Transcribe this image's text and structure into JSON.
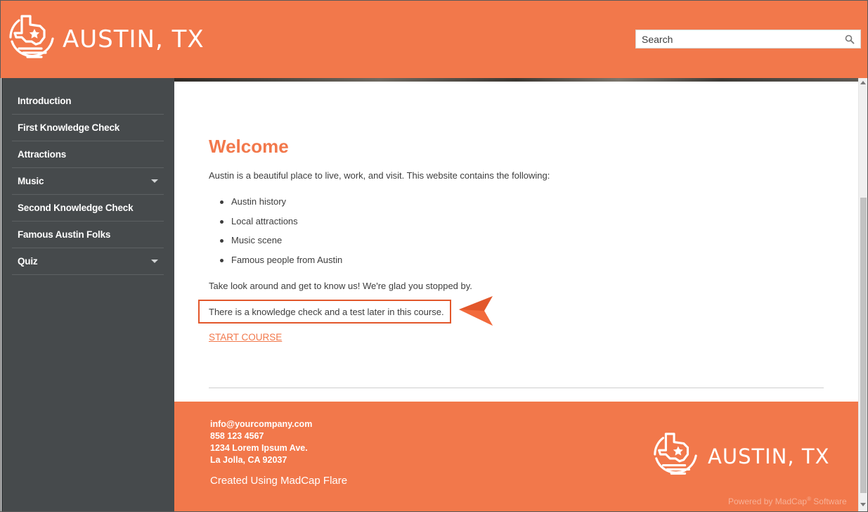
{
  "header": {
    "logo_text": "AUSTIN, TX",
    "logo_icon": "texas-star-logo-icon",
    "search": {
      "placeholder": "Search",
      "icon": "search-icon"
    }
  },
  "sidebar": {
    "items": [
      {
        "label": "Introduction",
        "has_submenu": false
      },
      {
        "label": "First Knowledge Check",
        "has_submenu": false
      },
      {
        "label": "Attractions",
        "has_submenu": false
      },
      {
        "label": "Music",
        "has_submenu": true
      },
      {
        "label": "Second Knowledge Check",
        "has_submenu": false
      },
      {
        "label": "Famous Austin Folks",
        "has_submenu": false
      },
      {
        "label": "Quiz",
        "has_submenu": true
      }
    ]
  },
  "main": {
    "title": "Welcome",
    "intro": "Austin is a beautiful place to live, work, and visit. This website contains the following:",
    "bullets": [
      "Austin history",
      "Local attractions",
      "Music scene",
      "Famous people from Austin"
    ],
    "take_look": "Take look around and get to know us! We're glad you stopped by.",
    "callout": "There is a knowledge check and a test later in this course.",
    "start_link": "START COURSE"
  },
  "footer": {
    "email": "info@yourcompany.com",
    "phone": "858 123 4567",
    "address1": "1234 Lorem Ipsum Ave.",
    "address2": "La Jolla, CA 92037",
    "created": "Created Using MadCap Flare",
    "logo_text": "AUSTIN, TX",
    "powered_prefix": "Powered by MadCap",
    "powered_mark": "®",
    "powered_suffix": " Software"
  },
  "colors": {
    "accent": "#f2784b",
    "sidebar": "#464a4c",
    "callout_border": "#e2572b"
  }
}
